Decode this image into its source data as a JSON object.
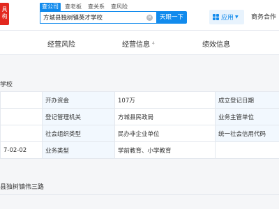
{
  "header": {
    "logo_lines": [
      "具",
      "构"
    ],
    "search_tabs": [
      "查公司",
      "查老板",
      "查关系",
      "查风险"
    ],
    "search_value": "方城县独树镇英才学校",
    "search_button": "天眼一下",
    "app_menu_label": "应用",
    "business_link": "商务合作"
  },
  "nav": {
    "tabs": [
      {
        "label": "经营风险",
        "count": ""
      },
      {
        "label": "经营信息",
        "count": "4"
      },
      {
        "label": "绩效信息",
        "count": ""
      }
    ]
  },
  "company": {
    "name_fragment": "学校",
    "address_fragment": "县独树镇伟三路"
  },
  "info_table": {
    "rows": [
      {
        "edge": "",
        "label1": "开办资金",
        "value1": "107万",
        "label2": "成立登记日期"
      },
      {
        "edge": "",
        "label1": "登记管理机关",
        "value1": "方城县民政局",
        "label2": "业务主管单位"
      },
      {
        "edge": "",
        "label1": "社会组织类型",
        "value1": "民办非企业单位",
        "label2": "统一社会信用代码"
      },
      {
        "edge": "7-02-02",
        "label1": "业务类型",
        "value1": "学前教育、小学教育",
        "label2": ""
      }
    ]
  },
  "colors": {
    "brand_red": "#e3281f",
    "accent_blue": "#128bed",
    "label_bg": "#f2f8fe",
    "page_bg": "#f5f6f8"
  }
}
